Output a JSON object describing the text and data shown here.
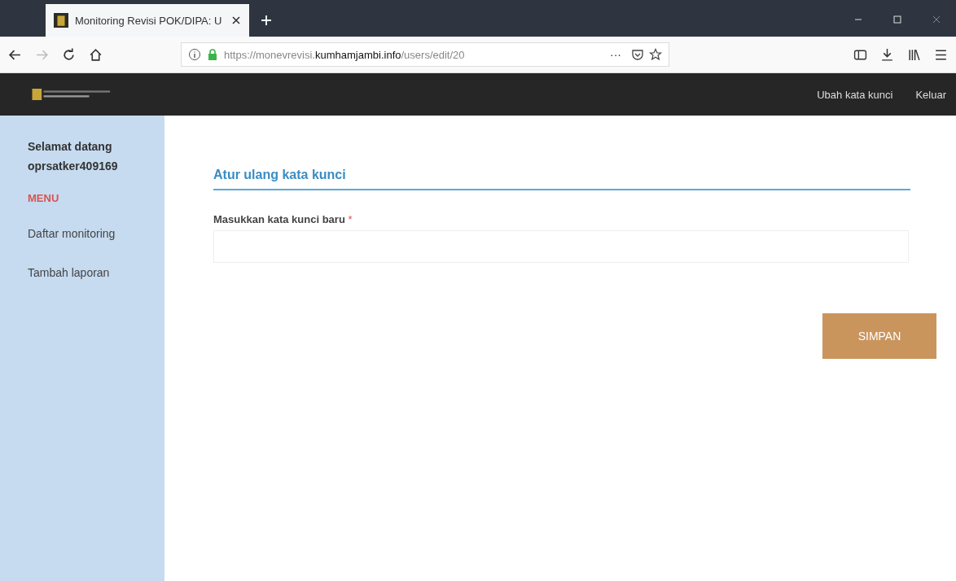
{
  "browser": {
    "tab_title": "Monitoring Revisi POK/DIPA: U",
    "url_prefix": "https://monevrevisi.",
    "url_domain": "kumhamjambi.info",
    "url_path": "/users/edit/20",
    "page_actions": "···"
  },
  "navbar": {
    "links": [
      {
        "label": "Ubah kata kunci"
      },
      {
        "label": "Keluar"
      }
    ]
  },
  "sidebar": {
    "greeting": "Selamat datang",
    "username": "oprsatker409169",
    "menu_heading": "MENU",
    "items": [
      {
        "label": "Daftar monitoring"
      },
      {
        "label": "Tambah laporan"
      }
    ]
  },
  "form": {
    "heading": "Atur ulang kata kunci",
    "field_label": "Masukkan kata kunci baru",
    "required_mark": "*",
    "submit": "SIMPAN"
  }
}
